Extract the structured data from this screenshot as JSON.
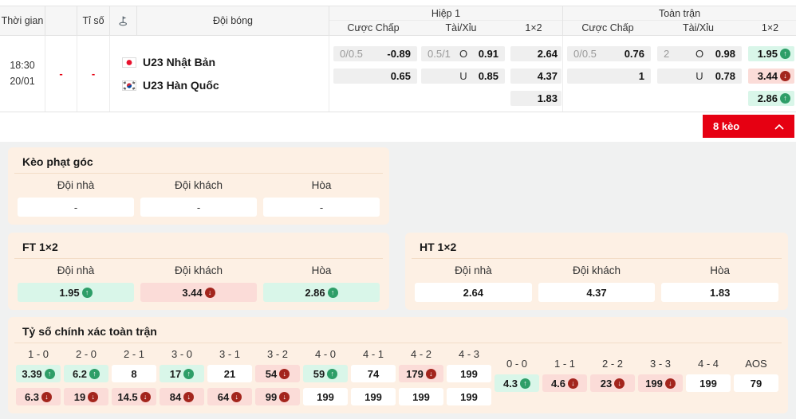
{
  "table": {
    "col_time": "Thời gian",
    "col_score": "Tỉ số",
    "col_team": "Đội bóng",
    "group_h1": "Hiệp 1",
    "group_ft": "Toàn trận",
    "sub_handicap": "Cược Chấp",
    "sub_ou": "Tài/Xỉu",
    "sub_1x2": "1×2",
    "match": {
      "time": "18:30",
      "date": "20/01",
      "live": "-",
      "score": "-",
      "home": "U23 Nhật Bản",
      "away": "U23 Hàn Quốc"
    },
    "h1": {
      "hcp_line": "0/0.5",
      "hcp_home": "-0.89",
      "hcp_away": "0.65",
      "ou_line": "0.5/1",
      "o_label": "O",
      "ou_over": "0.91",
      "u_label": "U",
      "ou_under": "0.85",
      "x2_home": "2.64",
      "x2_away": "4.37",
      "x2_draw": "1.83"
    },
    "ft": {
      "hcp_line": "0/0.5",
      "hcp_home": "0.76",
      "hcp_away": "1",
      "ou_line": "2",
      "o_label": "O",
      "ou_over": "0.98",
      "u_label": "U",
      "ou_under": "0.78",
      "x2_home": {
        "v": "1.95",
        "t": "up"
      },
      "x2_away": {
        "v": "3.44",
        "t": "down"
      },
      "x2_draw": {
        "v": "2.86",
        "t": "up"
      }
    },
    "expand": {
      "label": "8 kèo"
    }
  },
  "corner": {
    "title": "Kèo phạt góc",
    "col_home": "Đội nhà",
    "col_away": "Đội khách",
    "col_draw": "Hòa",
    "home": "-",
    "away": "-",
    "draw": "-"
  },
  "ft1x2": {
    "title": "FT 1×2",
    "col_home": "Đội nhà",
    "col_away": "Đội khách",
    "col_draw": "Hòa",
    "home": {
      "v": "1.95",
      "t": "up"
    },
    "away": {
      "v": "3.44",
      "t": "down"
    },
    "draw": {
      "v": "2.86",
      "t": "up"
    }
  },
  "ht1x2": {
    "title": "HT 1×2",
    "col_home": "Đội nhà",
    "col_away": "Đội khách",
    "col_draw": "Hòa",
    "home": {
      "v": "2.64",
      "t": "flat"
    },
    "away": {
      "v": "4.37",
      "t": "flat"
    },
    "draw": {
      "v": "1.83",
      "t": "flat"
    }
  },
  "correct_score": {
    "title": "Tỷ số chính xác toàn trận",
    "cols": [
      {
        "label": "1 - 0",
        "top": {
          "v": "3.39",
          "t": "up"
        },
        "bot": {
          "v": "6.3",
          "t": "down"
        }
      },
      {
        "label": "2 - 0",
        "top": {
          "v": "6.2",
          "t": "up"
        },
        "bot": {
          "v": "19",
          "t": "down"
        }
      },
      {
        "label": "2 - 1",
        "top": {
          "v": "8",
          "t": "flat"
        },
        "bot": {
          "v": "14.5",
          "t": "down"
        }
      },
      {
        "label": "3 - 0",
        "top": {
          "v": "17",
          "t": "up"
        },
        "bot": {
          "v": "84",
          "t": "down"
        }
      },
      {
        "label": "3 - 1",
        "top": {
          "v": "21",
          "t": "flat"
        },
        "bot": {
          "v": "64",
          "t": "down"
        }
      },
      {
        "label": "3 - 2",
        "top": {
          "v": "54",
          "t": "down"
        },
        "bot": {
          "v": "99",
          "t": "down"
        }
      },
      {
        "label": "4 - 0",
        "top": {
          "v": "59",
          "t": "up"
        },
        "bot": {
          "v": "199",
          "t": "flat"
        }
      },
      {
        "label": "4 - 1",
        "top": {
          "v": "74",
          "t": "flat"
        },
        "bot": {
          "v": "199",
          "t": "flat"
        }
      },
      {
        "label": "4 - 2",
        "top": {
          "v": "179",
          "t": "down"
        },
        "bot": {
          "v": "199",
          "t": "flat"
        }
      },
      {
        "label": "4 - 3",
        "top": {
          "v": "199",
          "t": "flat"
        },
        "bot": {
          "v": "199",
          "t": "flat"
        }
      }
    ],
    "draws": [
      {
        "label": "0 - 0",
        "odd": {
          "v": "4.3",
          "t": "up"
        }
      },
      {
        "label": "1 - 1",
        "odd": {
          "v": "4.6",
          "t": "down"
        }
      },
      {
        "label": "2 - 2",
        "odd": {
          "v": "23",
          "t": "down"
        }
      },
      {
        "label": "3 - 3",
        "odd": {
          "v": "199",
          "t": "down"
        }
      },
      {
        "label": "4 - 4",
        "odd": {
          "v": "199",
          "t": "flat"
        }
      },
      {
        "label": "AOS",
        "odd": {
          "v": "79",
          "t": "flat"
        }
      }
    ]
  },
  "icons": {
    "corner_flag": "corner-flag-icon",
    "expand_chevron": "chevron-up-icon",
    "trend_up": "arrow-up-circle-icon",
    "trend_down": "arrow-down-circle-icon",
    "home_flag": "japan-flag-icon",
    "away_flag": "korea-flag-icon"
  },
  "colors": {
    "accent_red": "#e60012",
    "trend_up_green": "#2e9e68",
    "trend_down_red": "#a3251d",
    "up_cell_bg": "#d9f6e9",
    "down_cell_bg": "#fbdcd8",
    "section_bg": "#fdf0e4"
  }
}
